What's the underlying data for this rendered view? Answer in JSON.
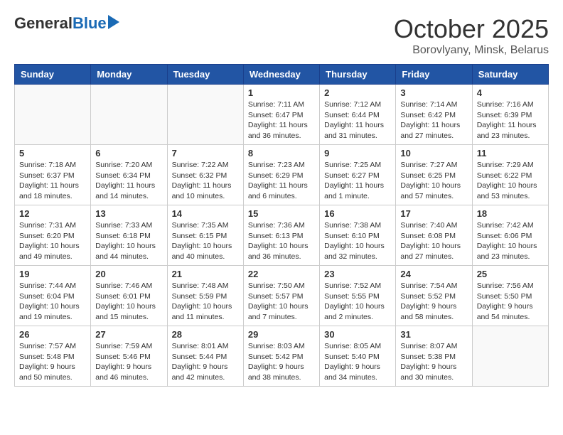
{
  "logo": {
    "general": "General",
    "blue": "Blue"
  },
  "header": {
    "month": "October 2025",
    "location": "Borovlyany, Minsk, Belarus"
  },
  "days_of_week": [
    "Sunday",
    "Monday",
    "Tuesday",
    "Wednesday",
    "Thursday",
    "Friday",
    "Saturday"
  ],
  "weeks": [
    [
      {
        "day": "",
        "info": ""
      },
      {
        "day": "",
        "info": ""
      },
      {
        "day": "",
        "info": ""
      },
      {
        "day": "1",
        "info": "Sunrise: 7:11 AM\nSunset: 6:47 PM\nDaylight: 11 hours\nand 36 minutes."
      },
      {
        "day": "2",
        "info": "Sunrise: 7:12 AM\nSunset: 6:44 PM\nDaylight: 11 hours\nand 31 minutes."
      },
      {
        "day": "3",
        "info": "Sunrise: 7:14 AM\nSunset: 6:42 PM\nDaylight: 11 hours\nand 27 minutes."
      },
      {
        "day": "4",
        "info": "Sunrise: 7:16 AM\nSunset: 6:39 PM\nDaylight: 11 hours\nand 23 minutes."
      }
    ],
    [
      {
        "day": "5",
        "info": "Sunrise: 7:18 AM\nSunset: 6:37 PM\nDaylight: 11 hours\nand 18 minutes."
      },
      {
        "day": "6",
        "info": "Sunrise: 7:20 AM\nSunset: 6:34 PM\nDaylight: 11 hours\nand 14 minutes."
      },
      {
        "day": "7",
        "info": "Sunrise: 7:22 AM\nSunset: 6:32 PM\nDaylight: 11 hours\nand 10 minutes."
      },
      {
        "day": "8",
        "info": "Sunrise: 7:23 AM\nSunset: 6:29 PM\nDaylight: 11 hours\nand 6 minutes."
      },
      {
        "day": "9",
        "info": "Sunrise: 7:25 AM\nSunset: 6:27 PM\nDaylight: 11 hours\nand 1 minute."
      },
      {
        "day": "10",
        "info": "Sunrise: 7:27 AM\nSunset: 6:25 PM\nDaylight: 10 hours\nand 57 minutes."
      },
      {
        "day": "11",
        "info": "Sunrise: 7:29 AM\nSunset: 6:22 PM\nDaylight: 10 hours\nand 53 minutes."
      }
    ],
    [
      {
        "day": "12",
        "info": "Sunrise: 7:31 AM\nSunset: 6:20 PM\nDaylight: 10 hours\nand 49 minutes."
      },
      {
        "day": "13",
        "info": "Sunrise: 7:33 AM\nSunset: 6:18 PM\nDaylight: 10 hours\nand 44 minutes."
      },
      {
        "day": "14",
        "info": "Sunrise: 7:35 AM\nSunset: 6:15 PM\nDaylight: 10 hours\nand 40 minutes."
      },
      {
        "day": "15",
        "info": "Sunrise: 7:36 AM\nSunset: 6:13 PM\nDaylight: 10 hours\nand 36 minutes."
      },
      {
        "day": "16",
        "info": "Sunrise: 7:38 AM\nSunset: 6:10 PM\nDaylight: 10 hours\nand 32 minutes."
      },
      {
        "day": "17",
        "info": "Sunrise: 7:40 AM\nSunset: 6:08 PM\nDaylight: 10 hours\nand 27 minutes."
      },
      {
        "day": "18",
        "info": "Sunrise: 7:42 AM\nSunset: 6:06 PM\nDaylight: 10 hours\nand 23 minutes."
      }
    ],
    [
      {
        "day": "19",
        "info": "Sunrise: 7:44 AM\nSunset: 6:04 PM\nDaylight: 10 hours\nand 19 minutes."
      },
      {
        "day": "20",
        "info": "Sunrise: 7:46 AM\nSunset: 6:01 PM\nDaylight: 10 hours\nand 15 minutes."
      },
      {
        "day": "21",
        "info": "Sunrise: 7:48 AM\nSunset: 5:59 PM\nDaylight: 10 hours\nand 11 minutes."
      },
      {
        "day": "22",
        "info": "Sunrise: 7:50 AM\nSunset: 5:57 PM\nDaylight: 10 hours\nand 7 minutes."
      },
      {
        "day": "23",
        "info": "Sunrise: 7:52 AM\nSunset: 5:55 PM\nDaylight: 10 hours\nand 2 minutes."
      },
      {
        "day": "24",
        "info": "Sunrise: 7:54 AM\nSunset: 5:52 PM\nDaylight: 9 hours\nand 58 minutes."
      },
      {
        "day": "25",
        "info": "Sunrise: 7:56 AM\nSunset: 5:50 PM\nDaylight: 9 hours\nand 54 minutes."
      }
    ],
    [
      {
        "day": "26",
        "info": "Sunrise: 7:57 AM\nSunset: 5:48 PM\nDaylight: 9 hours\nand 50 minutes."
      },
      {
        "day": "27",
        "info": "Sunrise: 7:59 AM\nSunset: 5:46 PM\nDaylight: 9 hours\nand 46 minutes."
      },
      {
        "day": "28",
        "info": "Sunrise: 8:01 AM\nSunset: 5:44 PM\nDaylight: 9 hours\nand 42 minutes."
      },
      {
        "day": "29",
        "info": "Sunrise: 8:03 AM\nSunset: 5:42 PM\nDaylight: 9 hours\nand 38 minutes."
      },
      {
        "day": "30",
        "info": "Sunrise: 8:05 AM\nSunset: 5:40 PM\nDaylight: 9 hours\nand 34 minutes."
      },
      {
        "day": "31",
        "info": "Sunrise: 8:07 AM\nSunset: 5:38 PM\nDaylight: 9 hours\nand 30 minutes."
      },
      {
        "day": "",
        "info": ""
      }
    ]
  ]
}
